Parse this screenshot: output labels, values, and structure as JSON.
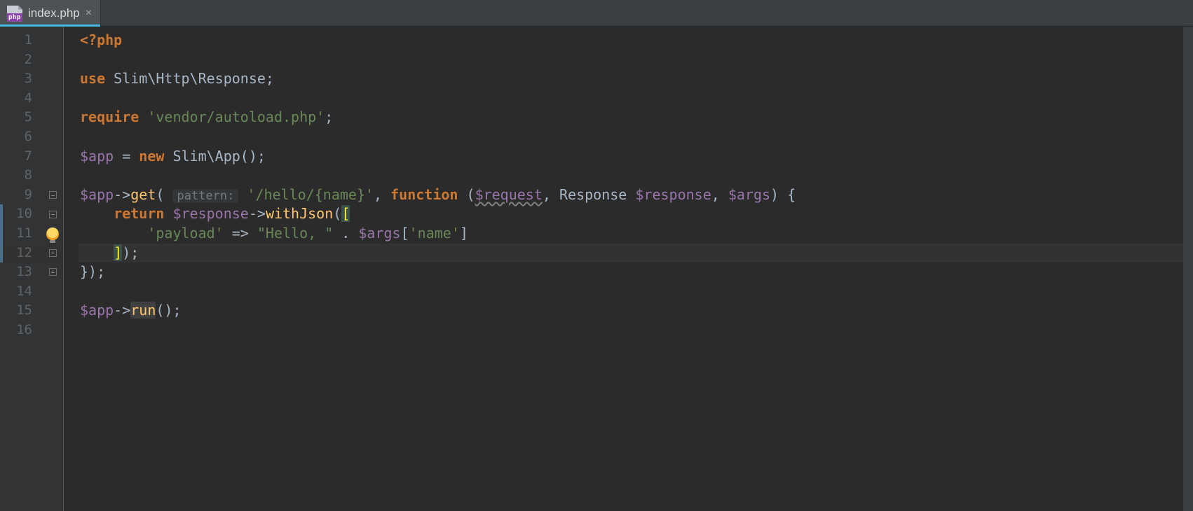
{
  "tab": {
    "file_type_badge": "php",
    "label": "index.php",
    "close_glyph": "×"
  },
  "gutter": {
    "line_numbers": [
      "1",
      "2",
      "3",
      "4",
      "5",
      "6",
      "7",
      "8",
      "9",
      "10",
      "11",
      "12",
      "13",
      "14",
      "15",
      "16"
    ]
  },
  "code": {
    "l1": {
      "open_tag": "<?php"
    },
    "l3": {
      "use": "use",
      "ns": " Slim\\Http\\Response",
      "semi": ";"
    },
    "l5": {
      "require": "require",
      "sp": " ",
      "path": "'vendor/autoload.php'",
      "semi": ";"
    },
    "l7": {
      "var": "$app",
      "eq": " = ",
      "new": "new",
      "cls": " Slim\\App",
      "call": "();"
    },
    "l9": {
      "var": "$app",
      "arrow": "->",
      "get": "get",
      "open": "(",
      "hint": "pattern:",
      "sp": " ",
      "route": "'/hello/{name}'",
      "comma": ", ",
      "func": "function",
      "sp2": " (",
      "req": "$request",
      "comma2": ", ",
      "resp_t": "Response ",
      "resp": "$response",
      "comma3": ", ",
      "args": "$args",
      "close": ") {"
    },
    "l10": {
      "indent": "    ",
      "return": "return",
      "sp": " ",
      "resp": "$response",
      "arrow": "->",
      "method": "withJson",
      "open": "(",
      "brk": "["
    },
    "l11": {
      "indent": "        ",
      "key": "'payload'",
      "fat": " => ",
      "hello": "\"Hello, \"",
      "dot": " . ",
      "args": "$args",
      "idx_open": "[",
      "idx_key": "'name'",
      "idx_close": "]"
    },
    "l12": {
      "indent": "    ",
      "brk": "]",
      "close": ");"
    },
    "l13": {
      "close": "});"
    },
    "l15": {
      "var": "$app",
      "arrow": "->",
      "run": "run",
      "call": "();"
    }
  },
  "icons": {
    "bulb": "intention-bulb"
  }
}
